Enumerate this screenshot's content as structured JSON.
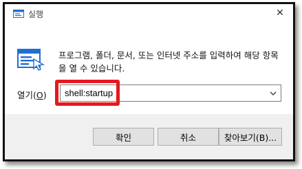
{
  "window": {
    "title": "실행",
    "close_glyph": "✕"
  },
  "prompt": {
    "description": "프로그램, 폴더, 문서, 또는 인터넷 주소를 입력하여 해당 항목을 열 수 있습니다."
  },
  "open_field": {
    "label_text": "열기(",
    "label_accel": "O",
    "label_close": ")",
    "value": "shell:startup"
  },
  "buttons": {
    "ok": "확인",
    "cancel": "취소",
    "browse": "찾아보기(B)..."
  },
  "colors": {
    "highlight": "#e5181e",
    "button_bar": "#f0f0f0",
    "run_icon_blue": "#1f6fd1"
  },
  "icons": {
    "app": "run-dialog-icon",
    "close": "close-icon",
    "dropdown": "chevron-down-icon"
  }
}
